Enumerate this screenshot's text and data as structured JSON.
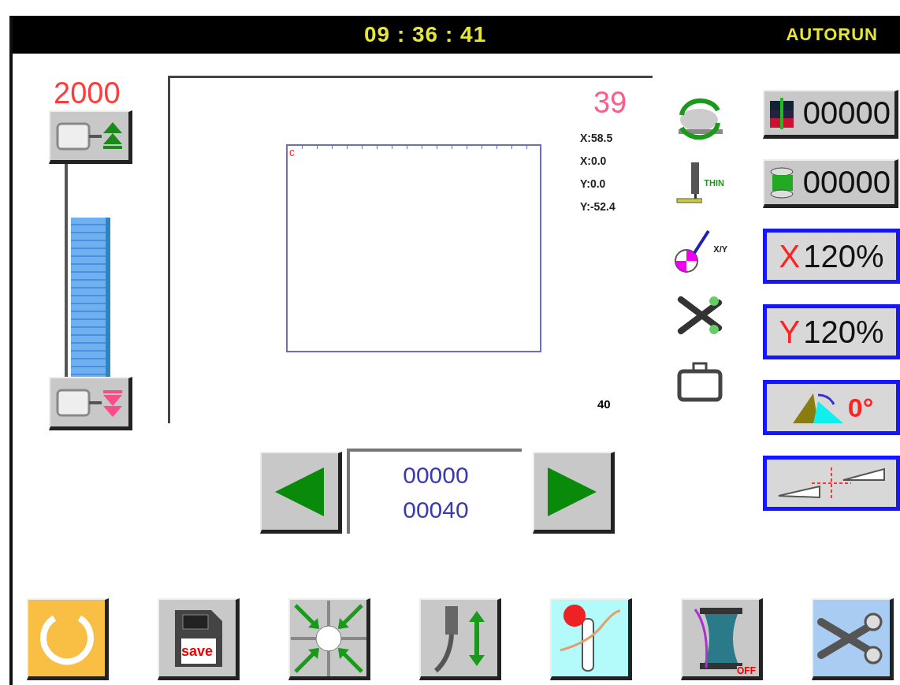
{
  "header": {
    "time": "09 : 36 : 41",
    "mode": "AUTORUN"
  },
  "speed": {
    "value": "2000",
    "level": 0.75
  },
  "canvas": {
    "start_mark": "c",
    "stitch_count": "39",
    "coordinates": [
      "X:58.5",
      "X:0.0",
      "Y:0.0",
      "Y:-52.4"
    ],
    "total": "40"
  },
  "tool_icons": [
    {
      "kind": "rotate"
    },
    {
      "kind": "presser",
      "label": "THIN"
    },
    {
      "kind": "origin",
      "label": "X/Y"
    },
    {
      "kind": "trim"
    },
    {
      "kind": "clamp"
    }
  ],
  "counters": [
    {
      "kind": "piece",
      "value": "00000"
    },
    {
      "kind": "bobbin",
      "value": "00000"
    }
  ],
  "settings": [
    {
      "kind": "x_scale",
      "axis": "X",
      "value": "120%"
    },
    {
      "kind": "y_scale",
      "axis": "Y",
      "value": "120%"
    },
    {
      "kind": "rotate",
      "value": "0°"
    },
    {
      "kind": "mirror"
    }
  ],
  "navigator": {
    "current": "00000",
    "total": "00040"
  },
  "toolbar": [
    {
      "kind": "ready",
      "color": "#f9bf45"
    },
    {
      "kind": "save",
      "label": "save",
      "color": "#c8c8c8"
    },
    {
      "kind": "home",
      "color": "#c8c8c8"
    },
    {
      "kind": "needle_height",
      "color": "#c8c8c8"
    },
    {
      "kind": "thread",
      "color": "#b3fbfb"
    },
    {
      "kind": "bobbin",
      "label": "OFF",
      "color": "#c8c8c8"
    },
    {
      "kind": "trim",
      "color": "#a9ccf2"
    }
  ]
}
